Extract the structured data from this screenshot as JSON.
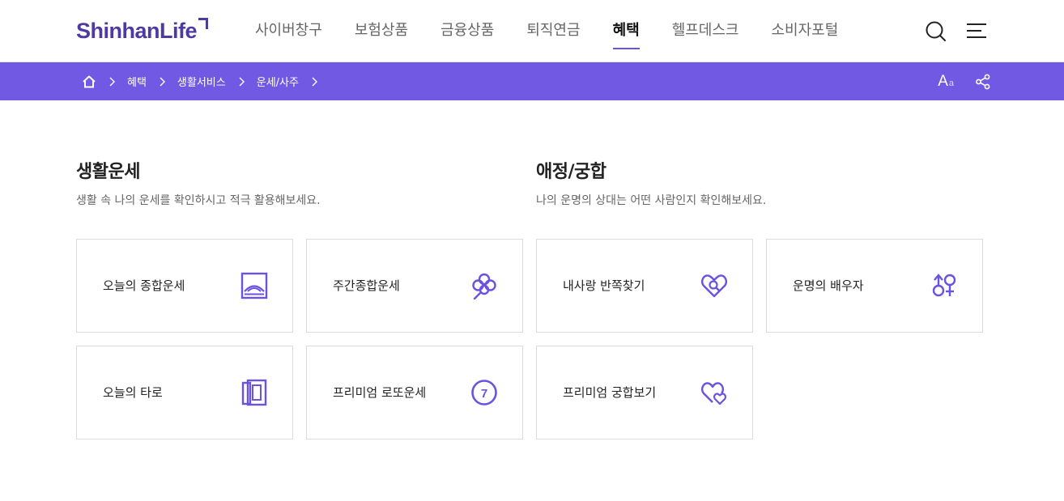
{
  "header": {
    "logo": "ShinhanLife",
    "nav": [
      "사이버창구",
      "보험상품",
      "금융상품",
      "퇴직연금",
      "혜택",
      "헬프데스크",
      "소비자포털"
    ],
    "active_nav_index": 4,
    "icons": [
      "search-icon",
      "menu-icon"
    ]
  },
  "breadcrumb": {
    "home_icon": "home-icon",
    "items": [
      "혜택",
      "생활서비스",
      "운세/사주"
    ],
    "font_size_button": {
      "big": "A",
      "small": "a"
    },
    "share_icon": "share-icon"
  },
  "colors": {
    "brand": "#4f3aa3",
    "accent": "#7159e3",
    "icon": "#6b52e0"
  },
  "sections": [
    {
      "title": "생활운세",
      "desc": "생활 속 나의 운세를 확인하시고 적극 활용해보세요.",
      "cards": [
        {
          "label": "오늘의 종합운세",
          "icon": "sunrise-frame-icon"
        },
        {
          "label": "주간종합운세",
          "icon": "clover-icon"
        },
        {
          "label": "오늘의 타로",
          "icon": "tarot-cards-icon"
        },
        {
          "label": "프리미엄 로또운세",
          "icon": "lotto-ball-icon"
        }
      ]
    },
    {
      "title": "애정/궁합",
      "desc": "나의 운명의 상대는 어떤 사람인지 확인해보세요.",
      "cards": [
        {
          "label": "내사랑 반쪽찾기",
          "icon": "heart-search-icon"
        },
        {
          "label": "운명의 배우자",
          "icon": "gender-symbols-icon"
        },
        {
          "label": "프리미엄 궁합보기",
          "icon": "double-heart-icon"
        }
      ]
    }
  ]
}
